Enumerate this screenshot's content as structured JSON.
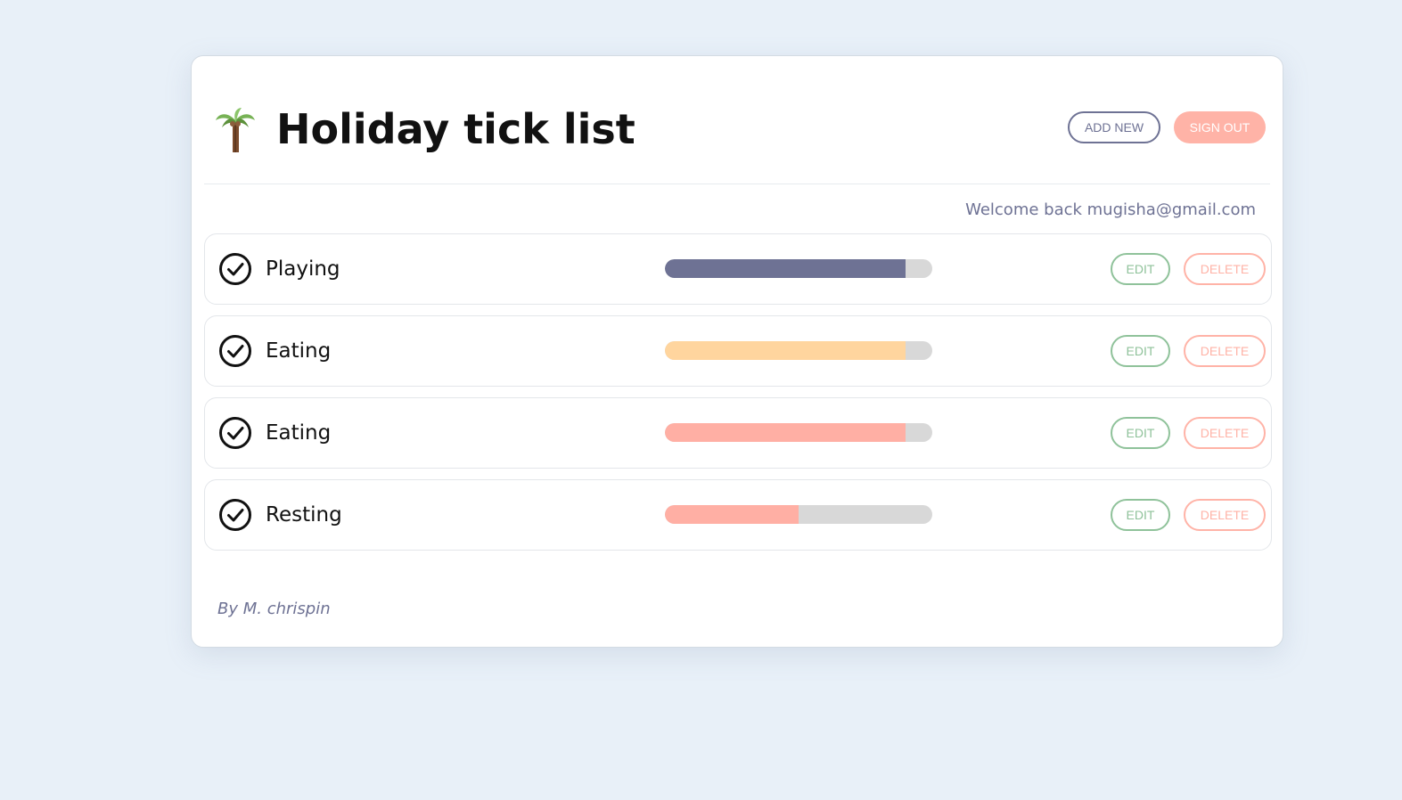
{
  "app": {
    "title": "Holiday tick list",
    "logo_icon": "palm-tree-icon"
  },
  "header": {
    "add_new_label": "ADD NEW",
    "sign_out_label": "SIGN OUT"
  },
  "welcome_text": "Welcome back mugisha@gmail.com",
  "items": [
    {
      "label": "Playing",
      "progress": 0.9,
      "color": "#6e7294",
      "edit_label": "EDIT",
      "delete_label": "DELETE"
    },
    {
      "label": "Eating",
      "progress": 0.9,
      "color": "#ffd59e",
      "edit_label": "EDIT",
      "delete_label": "DELETE"
    },
    {
      "label": "Eating",
      "progress": 0.9,
      "color": "#ffafa4",
      "edit_label": "EDIT",
      "delete_label": "DELETE"
    },
    {
      "label": "Resting",
      "progress": 0.5,
      "color": "#ffafa4",
      "edit_label": "EDIT",
      "delete_label": "DELETE"
    }
  ],
  "footer": {
    "credit": "By M. chrispin"
  },
  "colors": {
    "background": "#e8f0f8",
    "accent": "#6e7294",
    "edit": "#8fc29a",
    "delete": "#ffb3a7",
    "track": "#d8d8d8"
  }
}
